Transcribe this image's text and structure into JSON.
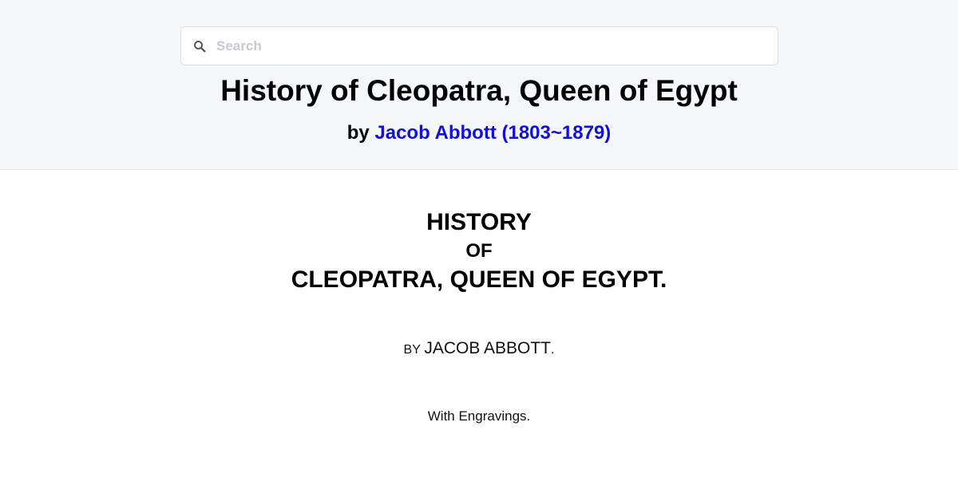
{
  "search": {
    "placeholder": "Search",
    "icon": "search-icon"
  },
  "header": {
    "title": "History of Cleopatra, Queen of Egypt",
    "by_prefix": "by",
    "author_link": "Jacob Abbott (1803~1879)",
    "link_color": "#0f0fe0"
  },
  "title_page": {
    "line1": "HISTORY",
    "line2": "OF",
    "line3": "CLEOPATRA, QUEEN OF EGYPT.",
    "by_label": "BY",
    "author": "JACOB ABBOTT",
    "author_suffix": ".",
    "engravings": "With Engravings."
  }
}
